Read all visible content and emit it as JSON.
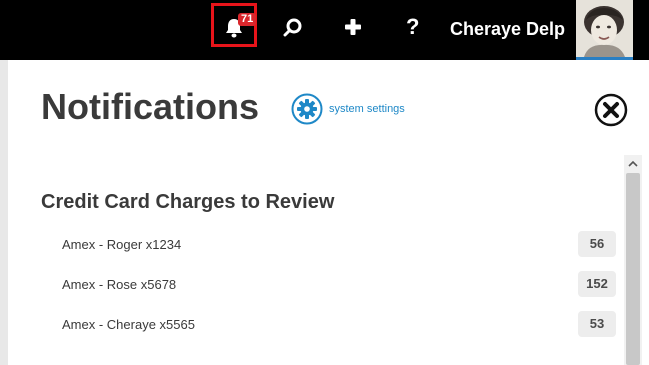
{
  "topbar": {
    "notifications": {
      "icon": "bell-icon",
      "badge_count": "71"
    },
    "search": {
      "icon": "search-icon"
    },
    "add": {
      "icon": "plus-icon"
    },
    "help": {
      "icon": "help-icon",
      "glyph": "?"
    },
    "user_name": "Cheraye Delp",
    "avatar": {
      "icon": "user-avatar-photo"
    }
  },
  "colors": {
    "topbar_bg": "#000000",
    "highlight_border": "#e8141a",
    "badge_bg": "#d9262c",
    "accent": "#1e88c7",
    "title_text": "#3a3a3a"
  },
  "panel": {
    "title": "Notifications",
    "settings_link": {
      "icon": "gear-icon",
      "label": "system settings"
    },
    "close": {
      "icon": "close-icon"
    },
    "section": {
      "title": "Credit Card Charges to Review",
      "items": [
        {
          "label": "Amex - Roger x1234",
          "count": "56"
        },
        {
          "label": "Amex - Rose x5678",
          "count": "152"
        },
        {
          "label": "Amex - Cheraye x5565",
          "count": "53"
        }
      ]
    }
  }
}
